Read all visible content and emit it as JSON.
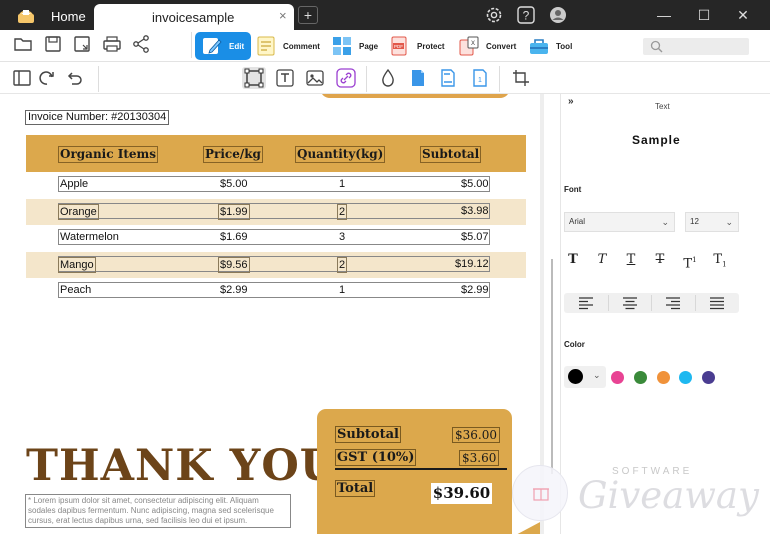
{
  "titlebar": {
    "home_tab": "Home",
    "doc_tab": "invoicesample",
    "close_tab": "×",
    "new_tab": "+",
    "icons": [
      "gear-icon",
      "help-icon",
      "avatar"
    ],
    "window_controls": {
      "minimize": "—",
      "maximize": "☐",
      "close": "✕"
    }
  },
  "toolbar": {
    "quick_actions": [
      "open-icon",
      "save-icon",
      "save-as-icon",
      "print-icon",
      "share-icon"
    ],
    "tools": [
      {
        "label": "Edit",
        "active": true
      },
      {
        "label": "Comment"
      },
      {
        "label": "Page"
      },
      {
        "label": "Protect"
      },
      {
        "label": "Convert"
      },
      {
        "label": "Tool"
      }
    ],
    "search_placeholder": ""
  },
  "edit_toolbar": {
    "icons": [
      "sidebar-toggle-icon",
      "redo-icon",
      "undo-icon",
      "select-box-icon",
      "add-text-icon",
      "add-image-icon",
      "add-link-icon",
      "watermark-icon",
      "background-icon",
      "header-footer-icon",
      "bates-number-icon",
      "crop-icon"
    ]
  },
  "invoice": {
    "number_label": "Invoice Number: #20130304",
    "headers": [
      "Organic Items",
      "Price/kg",
      "Quantity(kg)",
      "Subtotal"
    ],
    "rows": [
      {
        "item": "Apple",
        "price": "$5.00",
        "qty": "1",
        "subtotal": "$5.00"
      },
      {
        "item": "Orange",
        "price": "$1.99",
        "qty": "2",
        "subtotal": "$3.98"
      },
      {
        "item": "Watermelon",
        "price": "$1.69",
        "qty": "3",
        "subtotal": "$5.07"
      },
      {
        "item": "Mango",
        "price": "$9.56",
        "qty": "2",
        "subtotal": "$19.12"
      },
      {
        "item": "Peach",
        "price": "$2.99",
        "qty": "1",
        "subtotal": "$2.99"
      }
    ],
    "thank_you": "THANK YOU",
    "lorem": "* Lorem ipsum dolor sit amet, consectetur adipiscing elit. Aliquam sodales dapibus fermentum. Nunc adipiscing, magna sed scelerisque cursus, erat lectus dapibus urna, sed facilisis leo dui et ipsum.",
    "totals": {
      "subtotal_label": "Subtotal",
      "subtotal_value": "$36.00",
      "gst_label": "GST (10%)",
      "gst_value": "$3.60",
      "total_label": "Total",
      "total_value": "$39.60"
    },
    "accent_color": "#dca84c"
  },
  "watermark": {
    "software": "SOFTWARE",
    "giveaway": "Giveaway"
  },
  "panel": {
    "collapse": "»",
    "heading": "Text",
    "sample": "Sample",
    "font_label": "Font",
    "font_family": "Arial",
    "font_size": "12",
    "styles": [
      "T",
      "T",
      "T",
      "T",
      "T",
      "T"
    ],
    "align_icons": [
      "align-left-icon",
      "align-center-icon",
      "align-right-icon",
      "align-justify-icon"
    ],
    "color_label": "Color",
    "selected_color": "#000000",
    "swatches": [
      "#e84393",
      "#3a8a3a",
      "#f0923a",
      "#1eb8f0",
      "#4a3d91"
    ]
  }
}
